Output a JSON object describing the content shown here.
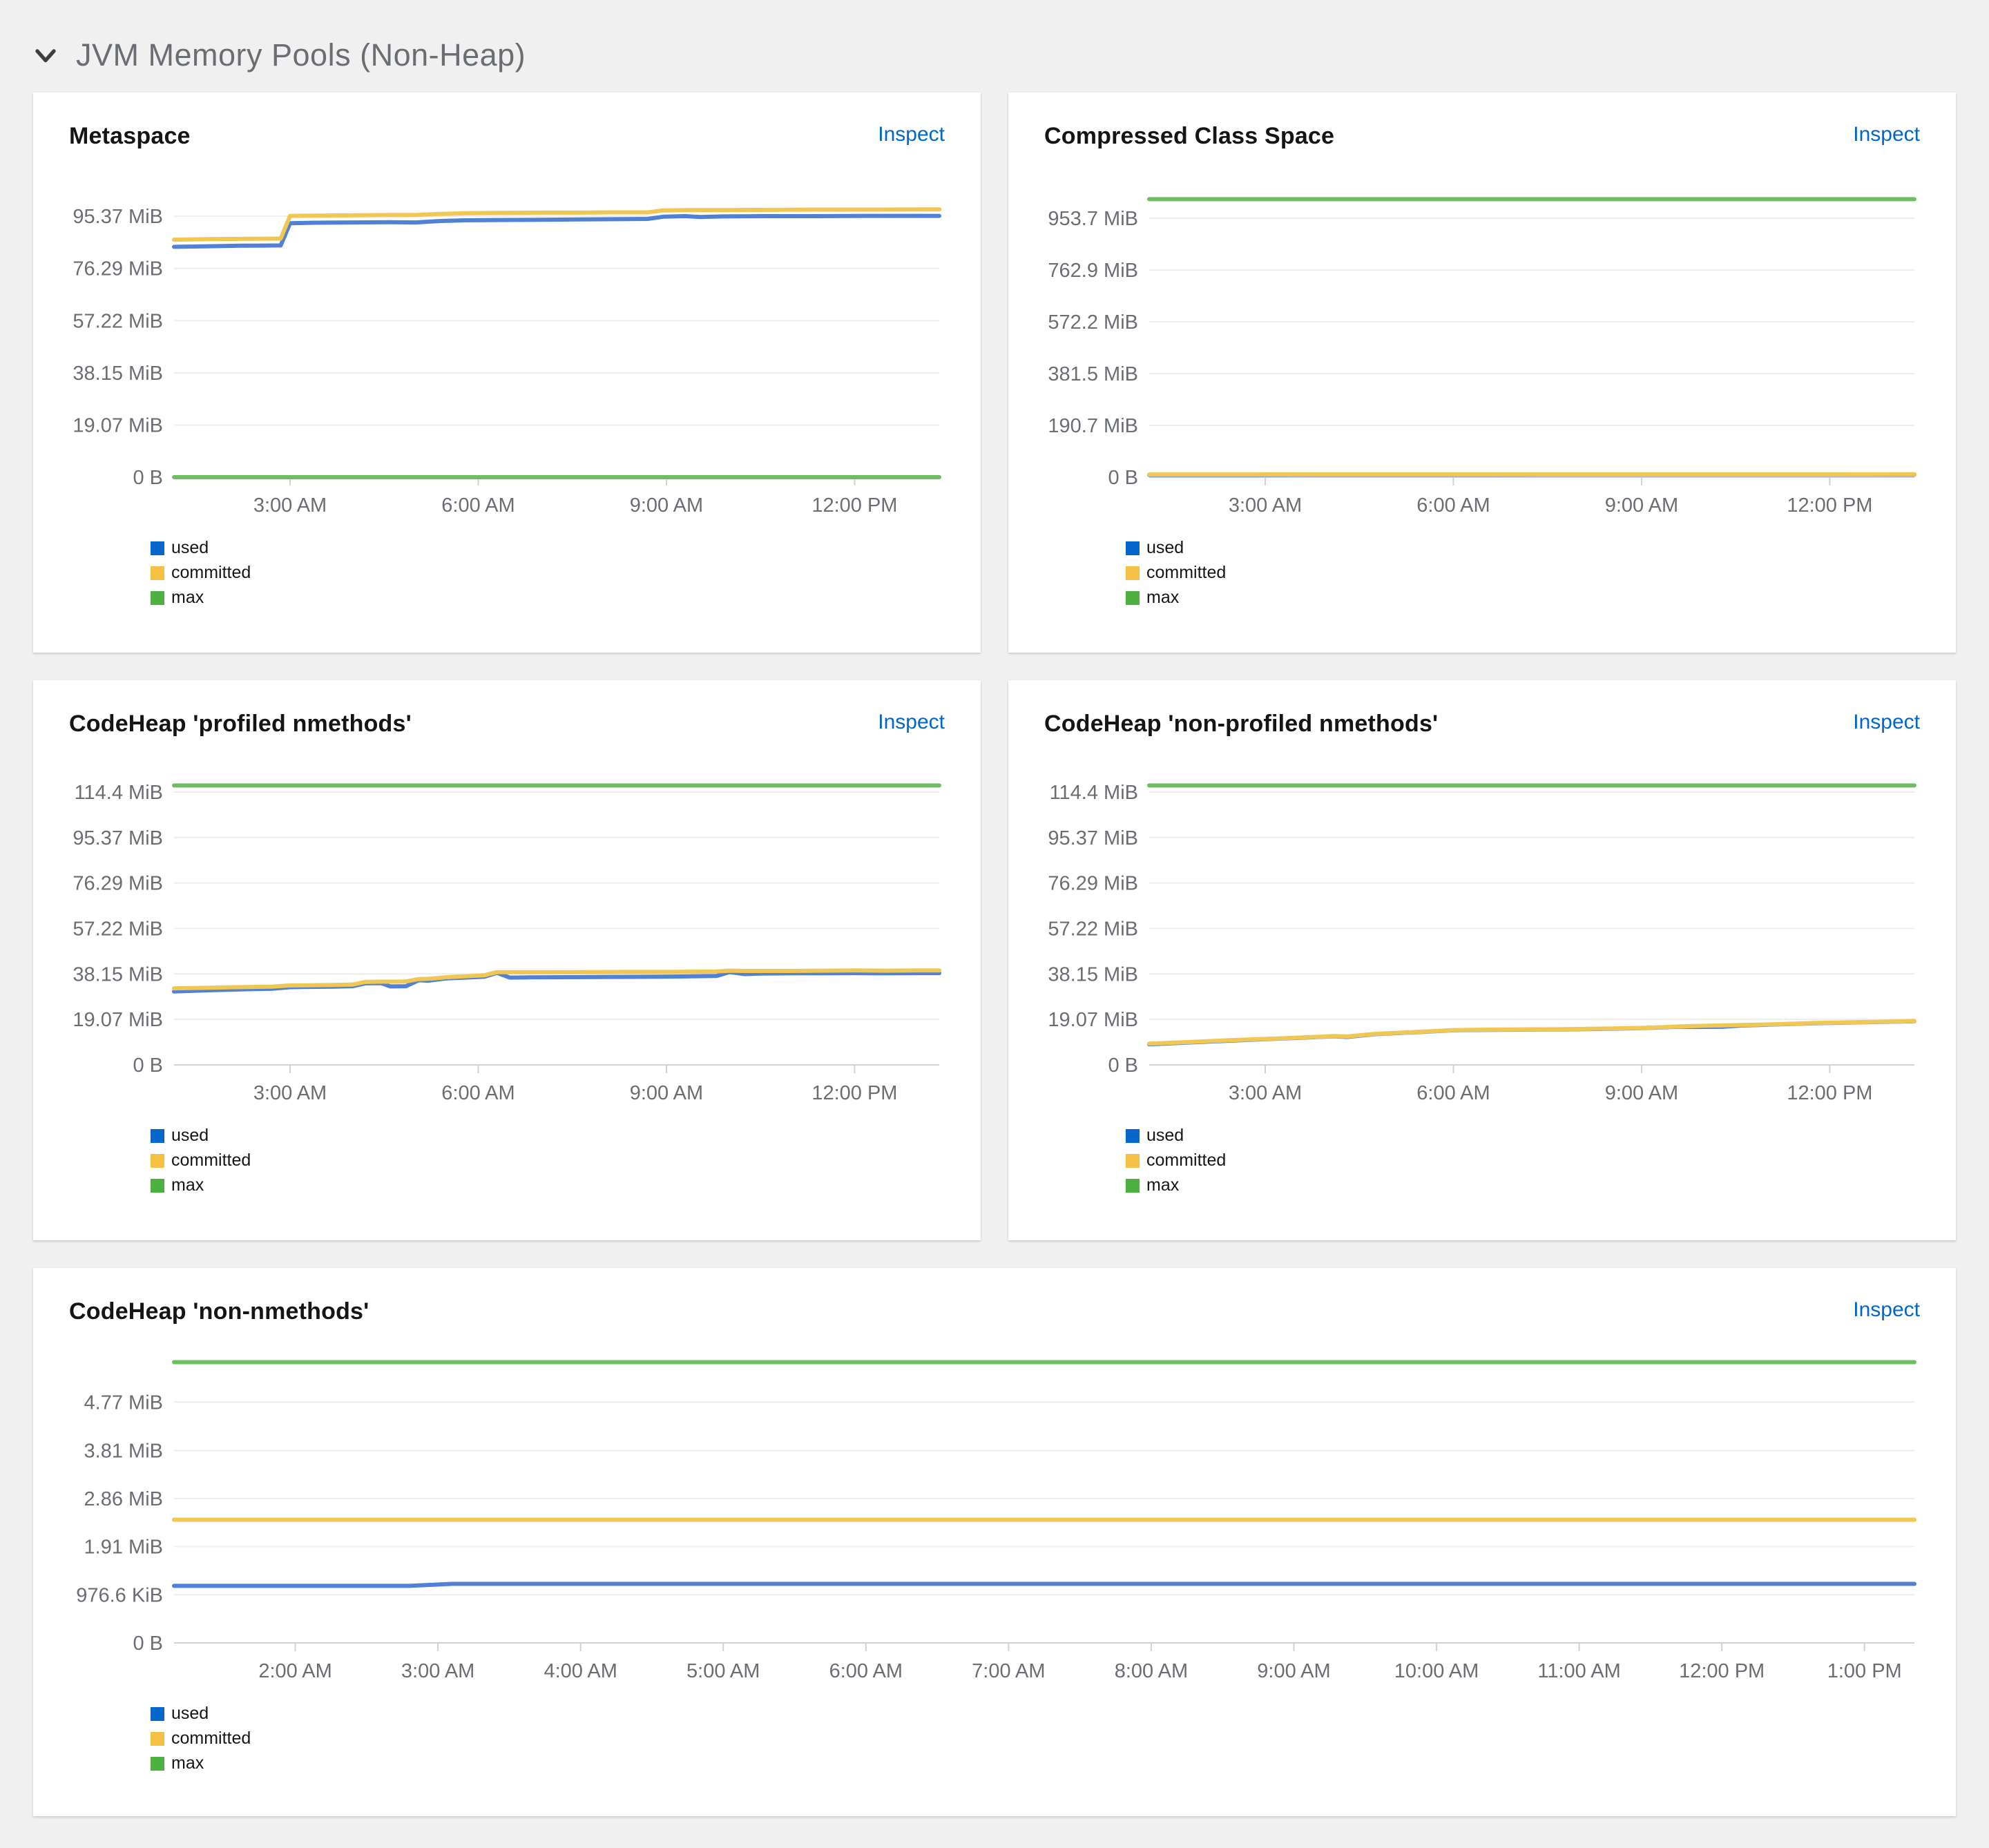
{
  "section": {
    "title": "JVM Memory Pools (Non-Heap)"
  },
  "colors": {
    "background": "#f0f0f0",
    "card": "#ffffff",
    "link": "#0066cc",
    "axis_label": "#6a6e73",
    "gridline": "#ededed",
    "axis_tick": "#d2d2d2",
    "title_text": "#151515"
  },
  "series_meta": [
    {
      "key": "used",
      "label": "used",
      "line": "#5081d4",
      "swatch": "#0666cc"
    },
    {
      "key": "committed",
      "label": "committed",
      "line": "#f0c654",
      "swatch": "#f4c145"
    },
    {
      "key": "max",
      "label": "max",
      "line": "#6cbe60",
      "swatch": "#4cb140"
    }
  ],
  "charts": [
    {
      "title": "Metaspace",
      "inspect_label": "Inspect",
      "type": "line",
      "x_domain": [
        1.15,
        13.35
      ],
      "y_max": 105,
      "x_ticks": [
        {
          "v": 3,
          "label": "3:00 AM"
        },
        {
          "v": 6,
          "label": "6:00 AM"
        },
        {
          "v": 9,
          "label": "9:00 AM"
        },
        {
          "v": 12,
          "label": "12:00 PM"
        }
      ],
      "y_ticks": [
        {
          "v": 0,
          "label": "0 B"
        },
        {
          "v": 19.07,
          "label": "19.07 MiB"
        },
        {
          "v": 38.15,
          "label": "38.15 MiB"
        },
        {
          "v": 57.22,
          "label": "57.22 MiB"
        },
        {
          "v": 76.29,
          "label": "76.29 MiB"
        },
        {
          "v": 95.37,
          "label": "95.37 MiB"
        }
      ],
      "series": {
        "used": [
          [
            1.15,
            84.2
          ],
          [
            1.7,
            84.4
          ],
          [
            2.2,
            84.6
          ],
          [
            2.85,
            84.7
          ],
          [
            3.0,
            92.8
          ],
          [
            3.4,
            93.0
          ],
          [
            4.0,
            93.1
          ],
          [
            4.6,
            93.2
          ],
          [
            5.0,
            93.1
          ],
          [
            5.35,
            93.6
          ],
          [
            5.8,
            93.9
          ],
          [
            6.3,
            94.0
          ],
          [
            7.0,
            94.1
          ],
          [
            7.6,
            94.2
          ],
          [
            8.2,
            94.3
          ],
          [
            8.7,
            94.4
          ],
          [
            8.95,
            95.2
          ],
          [
            9.3,
            95.4
          ],
          [
            9.55,
            95.1
          ],
          [
            9.9,
            95.3
          ],
          [
            10.6,
            95.4
          ],
          [
            11.4,
            95.4
          ],
          [
            12.2,
            95.5
          ],
          [
            13.35,
            95.5
          ]
        ],
        "committed": [
          [
            1.15,
            86.8
          ],
          [
            1.7,
            87.0
          ],
          [
            2.2,
            87.1
          ],
          [
            2.85,
            87.2
          ],
          [
            3.0,
            95.5
          ],
          [
            3.4,
            95.6
          ],
          [
            4.0,
            95.7
          ],
          [
            4.6,
            95.8
          ],
          [
            5.0,
            95.8
          ],
          [
            5.35,
            96.2
          ],
          [
            5.8,
            96.5
          ],
          [
            6.3,
            96.6
          ],
          [
            7.0,
            96.7
          ],
          [
            7.6,
            96.7
          ],
          [
            8.2,
            96.8
          ],
          [
            8.7,
            96.8
          ],
          [
            8.95,
            97.5
          ],
          [
            9.3,
            97.6
          ],
          [
            9.9,
            97.6
          ],
          [
            10.6,
            97.7
          ],
          [
            11.4,
            97.8
          ],
          [
            12.2,
            97.8
          ],
          [
            13.35,
            97.9
          ]
        ],
        "max": [
          [
            1.15,
            0
          ],
          [
            13.35,
            0
          ]
        ]
      }
    },
    {
      "title": "Compressed Class Space",
      "inspect_label": "Inspect",
      "type": "line",
      "x_domain": [
        1.15,
        13.35
      ],
      "y_max": 1058,
      "x_ticks": [
        {
          "v": 3,
          "label": "3:00 AM"
        },
        {
          "v": 6,
          "label": "6:00 AM"
        },
        {
          "v": 9,
          "label": "9:00 AM"
        },
        {
          "v": 12,
          "label": "12:00 PM"
        }
      ],
      "y_ticks": [
        {
          "v": 0,
          "label": "0 B"
        },
        {
          "v": 190.7,
          "label": "190.7 MiB"
        },
        {
          "v": 381.5,
          "label": "381.5 MiB"
        },
        {
          "v": 572.2,
          "label": "572.2 MiB"
        },
        {
          "v": 762.9,
          "label": "762.9 MiB"
        },
        {
          "v": 953.7,
          "label": "953.7 MiB"
        }
      ],
      "series": {
        "used": [
          [
            1.15,
            8.3
          ],
          [
            2.0,
            8.4
          ],
          [
            2.85,
            8.5
          ],
          [
            3.05,
            9.0
          ],
          [
            4.0,
            9.1
          ],
          [
            6.0,
            9.2
          ],
          [
            8.0,
            9.3
          ],
          [
            10.0,
            9.4
          ],
          [
            12.0,
            9.5
          ],
          [
            13.35,
            9.6
          ]
        ],
        "committed": [
          [
            1.15,
            9.8
          ],
          [
            2.85,
            9.8
          ],
          [
            3.05,
            10.4
          ],
          [
            6.0,
            10.5
          ],
          [
            10.0,
            10.5
          ],
          [
            13.35,
            10.6
          ]
        ],
        "max": [
          [
            1.15,
            1024
          ],
          [
            13.35,
            1024
          ]
        ]
      }
    },
    {
      "title": "CodeHeap 'profiled nmethods'",
      "inspect_label": "Inspect",
      "type": "line",
      "x_domain": [
        1.15,
        13.35
      ],
      "y_max": 120.5,
      "x_ticks": [
        {
          "v": 3,
          "label": "3:00 AM"
        },
        {
          "v": 6,
          "label": "6:00 AM"
        },
        {
          "v": 9,
          "label": "9:00 AM"
        },
        {
          "v": 12,
          "label": "12:00 PM"
        }
      ],
      "y_ticks": [
        {
          "v": 0,
          "label": "0 B"
        },
        {
          "v": 19.07,
          "label": "19.07 MiB"
        },
        {
          "v": 38.15,
          "label": "38.15 MiB"
        },
        {
          "v": 57.22,
          "label": "57.22 MiB"
        },
        {
          "v": 76.29,
          "label": "76.29 MiB"
        },
        {
          "v": 95.37,
          "label": "95.37 MiB"
        },
        {
          "v": 114.4,
          "label": "114.4 MiB"
        }
      ],
      "series": {
        "used": [
          [
            1.15,
            30.8
          ],
          [
            1.6,
            31.2
          ],
          [
            2.0,
            31.5
          ],
          [
            2.4,
            31.8
          ],
          [
            2.7,
            31.9
          ],
          [
            3.0,
            32.6
          ],
          [
            3.3,
            32.7
          ],
          [
            3.7,
            32.8
          ],
          [
            4.0,
            33.0
          ],
          [
            4.2,
            34.2
          ],
          [
            4.45,
            34.3
          ],
          [
            4.6,
            32.9
          ],
          [
            4.85,
            33.0
          ],
          [
            5.05,
            35.5
          ],
          [
            5.2,
            35.3
          ],
          [
            5.5,
            36.3
          ],
          [
            5.8,
            36.6
          ],
          [
            6.1,
            37.0
          ],
          [
            6.3,
            38.6
          ],
          [
            6.5,
            36.6
          ],
          [
            6.8,
            36.7
          ],
          [
            7.5,
            36.8
          ],
          [
            8.3,
            36.9
          ],
          [
            9.0,
            37.0
          ],
          [
            9.5,
            37.2
          ],
          [
            9.8,
            37.3
          ],
          [
            10.0,
            38.9
          ],
          [
            10.25,
            38.1
          ],
          [
            10.5,
            38.3
          ],
          [
            11.0,
            38.4
          ],
          [
            11.5,
            38.4
          ],
          [
            12.0,
            38.5
          ],
          [
            12.5,
            38.4
          ],
          [
            13.0,
            38.5
          ],
          [
            13.35,
            38.5
          ]
        ],
        "committed": [
          [
            1.15,
            32.1
          ],
          [
            1.6,
            32.3
          ],
          [
            2.0,
            32.5
          ],
          [
            2.4,
            32.7
          ],
          [
            2.7,
            32.8
          ],
          [
            3.0,
            33.3
          ],
          [
            3.3,
            33.4
          ],
          [
            3.7,
            33.5
          ],
          [
            4.0,
            33.7
          ],
          [
            4.2,
            34.8
          ],
          [
            4.45,
            34.9
          ],
          [
            4.6,
            34.9
          ],
          [
            4.85,
            35.0
          ],
          [
            5.05,
            36.0
          ],
          [
            5.2,
            36.1
          ],
          [
            5.5,
            36.8
          ],
          [
            5.8,
            37.2
          ],
          [
            6.1,
            37.6
          ],
          [
            6.3,
            38.9
          ],
          [
            6.5,
            38.9
          ],
          [
            6.8,
            38.9
          ],
          [
            7.5,
            38.9
          ],
          [
            8.3,
            39.0
          ],
          [
            9.0,
            39.0
          ],
          [
            9.5,
            39.1
          ],
          [
            9.8,
            39.2
          ],
          [
            10.0,
            39.5
          ],
          [
            10.25,
            39.4
          ],
          [
            10.5,
            39.4
          ],
          [
            11.0,
            39.4
          ],
          [
            11.5,
            39.5
          ],
          [
            12.0,
            39.6
          ],
          [
            12.5,
            39.5
          ],
          [
            13.0,
            39.6
          ],
          [
            13.35,
            39.6
          ]
        ],
        "max": [
          [
            1.15,
            117.2
          ],
          [
            13.35,
            117.2
          ]
        ]
      }
    },
    {
      "title": "CodeHeap 'non-profiled nmethods'",
      "inspect_label": "Inspect",
      "type": "line",
      "x_domain": [
        1.15,
        13.35
      ],
      "y_max": 120.5,
      "x_ticks": [
        {
          "v": 3,
          "label": "3:00 AM"
        },
        {
          "v": 6,
          "label": "6:00 AM"
        },
        {
          "v": 9,
          "label": "9:00 AM"
        },
        {
          "v": 12,
          "label": "12:00 PM"
        }
      ],
      "y_ticks": [
        {
          "v": 0,
          "label": "0 B"
        },
        {
          "v": 19.07,
          "label": "19.07 MiB"
        },
        {
          "v": 38.15,
          "label": "38.15 MiB"
        },
        {
          "v": 57.22,
          "label": "57.22 MiB"
        },
        {
          "v": 76.29,
          "label": "76.29 MiB"
        },
        {
          "v": 95.37,
          "label": "95.37 MiB"
        },
        {
          "v": 114.4,
          "label": "114.4 MiB"
        }
      ],
      "series": {
        "used": [
          [
            1.15,
            8.6
          ],
          [
            1.8,
            9.4
          ],
          [
            2.4,
            10.1
          ],
          [
            3.0,
            10.8
          ],
          [
            3.6,
            11.4
          ],
          [
            4.1,
            12.0
          ],
          [
            4.3,
            11.7
          ],
          [
            4.75,
            12.9
          ],
          [
            5.4,
            13.7
          ],
          [
            6.0,
            14.5
          ],
          [
            6.6,
            14.7
          ],
          [
            7.2,
            14.8
          ],
          [
            7.8,
            14.9
          ],
          [
            8.4,
            15.1
          ],
          [
            9.0,
            15.4
          ],
          [
            9.6,
            16.0
          ],
          [
            9.9,
            15.9
          ],
          [
            10.3,
            16.0
          ],
          [
            10.6,
            16.5
          ],
          [
            11.2,
            17.0
          ],
          [
            11.8,
            17.5
          ],
          [
            12.4,
            17.8
          ],
          [
            13.0,
            18.1
          ],
          [
            13.35,
            18.3
          ]
        ],
        "committed": [
          [
            1.15,
            8.9
          ],
          [
            1.8,
            9.6
          ],
          [
            2.4,
            10.3
          ],
          [
            3.0,
            10.9
          ],
          [
            3.6,
            11.5
          ],
          [
            4.1,
            12.1
          ],
          [
            4.3,
            11.9
          ],
          [
            4.75,
            13.0
          ],
          [
            5.4,
            13.8
          ],
          [
            6.0,
            14.6
          ],
          [
            6.6,
            14.8
          ],
          [
            7.2,
            14.9
          ],
          [
            7.8,
            15.0
          ],
          [
            8.4,
            15.2
          ],
          [
            9.0,
            15.5
          ],
          [
            9.6,
            16.1
          ],
          [
            10.0,
            16.4
          ],
          [
            10.6,
            16.7
          ],
          [
            11.2,
            17.1
          ],
          [
            11.8,
            17.6
          ],
          [
            12.4,
            17.9
          ],
          [
            13.0,
            18.2
          ],
          [
            13.35,
            18.4
          ]
        ],
        "max": [
          [
            1.15,
            117.2
          ],
          [
            13.35,
            117.2
          ]
        ]
      }
    },
    {
      "title": "CodeHeap 'non-nmethods'",
      "inspect_label": "Inspect",
      "type": "line",
      "x_domain": [
        1.15,
        13.35
      ],
      "y_max": 5.69,
      "x_ticks": [
        {
          "v": 2,
          "label": "2:00 AM"
        },
        {
          "v": 3,
          "label": "3:00 AM"
        },
        {
          "v": 4,
          "label": "4:00 AM"
        },
        {
          "v": 5,
          "label": "5:00 AM"
        },
        {
          "v": 6,
          "label": "6:00 AM"
        },
        {
          "v": 7,
          "label": "7:00 AM"
        },
        {
          "v": 8,
          "label": "8:00 AM"
        },
        {
          "v": 9,
          "label": "9:00 AM"
        },
        {
          "v": 10,
          "label": "10:00 AM"
        },
        {
          "v": 11,
          "label": "11:00 AM"
        },
        {
          "v": 12,
          "label": "12:00 PM"
        },
        {
          "v": 13,
          "label": "1:00 PM"
        }
      ],
      "y_ticks": [
        {
          "v": 0,
          "label": "0 B"
        },
        {
          "v": 0.9537,
          "label": "976.6 KiB"
        },
        {
          "v": 1.91,
          "label": "1.91 MiB"
        },
        {
          "v": 2.86,
          "label": "2.86 MiB"
        },
        {
          "v": 3.81,
          "label": "3.81 MiB"
        },
        {
          "v": 4.77,
          "label": "4.77 MiB"
        }
      ],
      "series": {
        "used": [
          [
            1.15,
            1.13
          ],
          [
            2.8,
            1.13
          ],
          [
            3.1,
            1.17
          ],
          [
            13.35,
            1.17
          ]
        ],
        "committed": [
          [
            1.15,
            2.44
          ],
          [
            13.35,
            2.44
          ]
        ],
        "max": [
          [
            1.15,
            5.56
          ],
          [
            13.35,
            5.56
          ]
        ]
      }
    }
  ]
}
